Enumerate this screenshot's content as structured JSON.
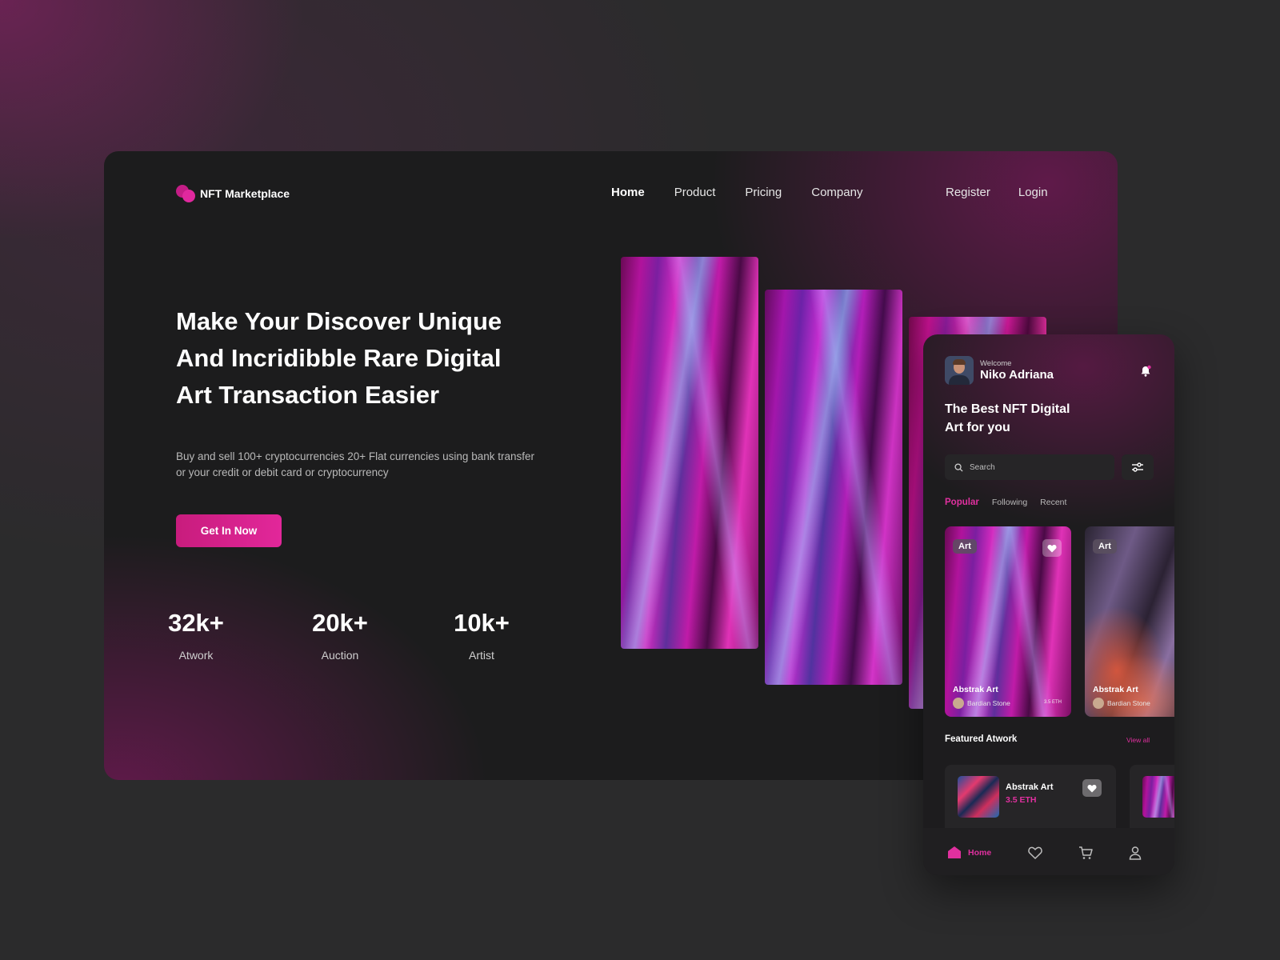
{
  "brand": {
    "name": "NFT Marketplace",
    "accent": "#e0289e"
  },
  "nav": {
    "links": [
      "Home",
      "Product",
      "Pricing",
      "Company"
    ],
    "active": "Home",
    "register": "Register",
    "login": "Login"
  },
  "hero": {
    "title_lines": [
      "Make Your Discover Unique",
      "And Incridibble Rare Digital",
      "Art Transaction Easier"
    ],
    "description": "Buy and sell 100+ cryptocurrencies 20+ Flat currencies using bank transfer or your credit or debit card or cryptocurrency",
    "cta": "Get In Now"
  },
  "stats": [
    {
      "value": "32k+",
      "label": "Atwork"
    },
    {
      "value": "20k+",
      "label": "Auction"
    },
    {
      "value": "10k+",
      "label": "Artist"
    }
  ],
  "mobile": {
    "welcome": "Welcome",
    "user": "Niko Adriana",
    "title_lines": [
      "The Best NFT Digital",
      "Art for you"
    ],
    "search_placeholder": "Search",
    "tabs": [
      "Popular",
      "Following",
      "Recent"
    ],
    "cards": [
      {
        "tag": "Art",
        "title": "Abstrak Art",
        "author": "Bardian Stone",
        "price": "3.5 ETH"
      },
      {
        "tag": "Art",
        "title": "Abstrak Art",
        "author": "Bardian Stone"
      }
    ],
    "featured_title": "Featured Atwork",
    "view_all": "View all",
    "featured": {
      "title": "Abstrak Art",
      "price": "3.5 ETH"
    },
    "bottom_nav": {
      "home": "Home",
      "icons": [
        "heart-icon",
        "cart-icon",
        "user-icon"
      ]
    }
  }
}
